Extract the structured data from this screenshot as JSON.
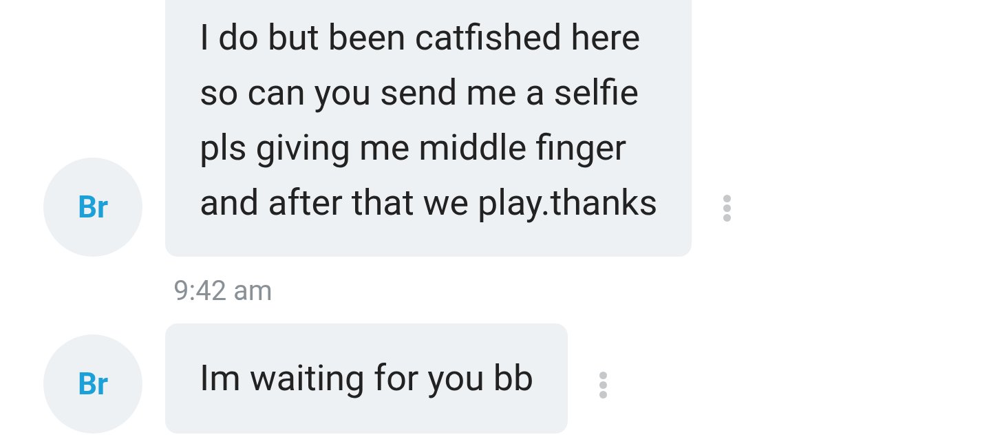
{
  "conversation": [
    {
      "kind": "message",
      "avatar": "Br",
      "lines": [
        "I do but been catfished here",
        "so can you send me a selfie",
        "pls giving me middle finger",
        "and after that we play.thanks"
      ]
    },
    {
      "kind": "timestamp",
      "text": "9:42 am"
    },
    {
      "kind": "message",
      "avatar": "Br",
      "lines": [
        "Im waiting for you bb"
      ]
    }
  ]
}
